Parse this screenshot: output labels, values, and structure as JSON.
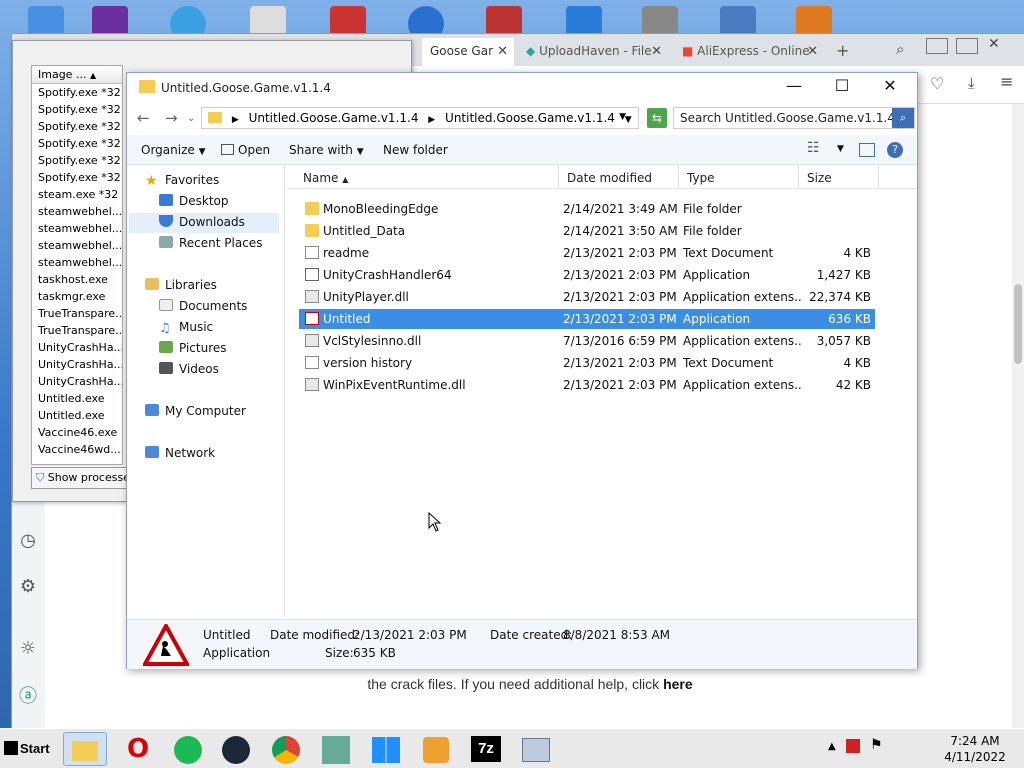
{
  "browser": {
    "tabs": [
      {
        "label": "Goose Gar",
        "active": true
      },
      {
        "label": "UploadHaven - File",
        "active": false
      },
      {
        "label": "AliExpress - Online",
        "active": false
      }
    ],
    "new_tab": "+",
    "page_text": "the crack files. If you need additional help, click",
    "page_link": "here"
  },
  "taskmgr": {
    "column": "Image ...",
    "processes": [
      "Spotify.exe *32",
      "Spotify.exe *32",
      "Spotify.exe *32",
      "Spotify.exe *32",
      "Spotify.exe *32",
      "Spotify.exe *32",
      "steam.exe *32",
      "steamwebhel...",
      "steamwebhel...",
      "steamwebhel...",
      "steamwebhel...",
      "taskhost.exe",
      "taskmgr.exe",
      "TrueTranspare...",
      "TrueTranspare...",
      "UnityCrashHa...",
      "UnityCrashHa...",
      "UnityCrashHa...",
      "Untitled.exe",
      "Untitled.exe",
      "Vaccine46.exe",
      "Vaccine46wd...."
    ],
    "show_processes": "Show processe"
  },
  "explorer": {
    "title": "Untitled.Goose.Game.v1.1.4",
    "breadcrumb": [
      "Untitled.Goose.Game.v1.1.4",
      "Untitled.Goose.Game.v1.1.4"
    ],
    "search_placeholder": "Search Untitled.Goose.Game.v1.1.4",
    "toolbar": {
      "organize": "Organize",
      "open": "Open",
      "share_with": "Share with",
      "new_folder": "New folder"
    },
    "nav": {
      "favorites": "Favorites",
      "desktop": "Desktop",
      "downloads": "Downloads",
      "recent_places": "Recent Places",
      "libraries": "Libraries",
      "documents": "Documents",
      "music": "Music",
      "pictures": "Pictures",
      "videos": "Videos",
      "my_computer": "My Computer",
      "network": "Network"
    },
    "columns": {
      "name": "Name",
      "date_modified": "Date modified",
      "type": "Type",
      "size": "Size"
    },
    "files": [
      {
        "name": "MonoBleedingEdge",
        "date": "2/14/2021 3:49 AM",
        "type": "File folder",
        "size": "",
        "icon": "folder-icon"
      },
      {
        "name": "Untitled_Data",
        "date": "2/14/2021 3:50 AM",
        "type": "File folder",
        "size": "",
        "icon": "folder-icon"
      },
      {
        "name": "readme",
        "date": "2/13/2021 2:03 PM",
        "type": "Text Document",
        "size": "4 KB",
        "icon": "text-file-icon"
      },
      {
        "name": "UnityCrashHandler64",
        "date": "2/13/2021 2:03 PM",
        "type": "Application",
        "size": "1,427 KB",
        "icon": "unity-icon"
      },
      {
        "name": "UnityPlayer.dll",
        "date": "2/13/2021 2:03 PM",
        "type": "Application extens...",
        "size": "22,374 KB",
        "icon": "dll-icon"
      },
      {
        "name": "Untitled",
        "date": "2/13/2021 2:03 PM",
        "type": "Application",
        "size": "636 KB",
        "icon": "goose-icon",
        "selected": true
      },
      {
        "name": "VclStylesinno.dll",
        "date": "7/13/2016 6:59 PM",
        "type": "Application extens...",
        "size": "3,057 KB",
        "icon": "dll-icon"
      },
      {
        "name": "version history",
        "date": "2/13/2021 2:03 PM",
        "type": "Text Document",
        "size": "4 KB",
        "icon": "text-file-icon"
      },
      {
        "name": "WinPixEventRuntime.dll",
        "date": "2/13/2021 2:03 PM",
        "type": "Application extens...",
        "size": "42 KB",
        "icon": "dll-icon"
      }
    ],
    "details": {
      "name": "Untitled",
      "type": "Application",
      "date_modified_label": "Date modified:",
      "date_modified": "2/13/2021 2:03 PM",
      "date_created_label": "Date created:",
      "date_created": "8/8/2021 8:53 AM",
      "size_label": "Size:",
      "size": "635 KB"
    }
  },
  "taskbar": {
    "start": "Start",
    "apps": [
      "explorer-icon",
      "opera-icon",
      "spotify-icon",
      "steam-icon",
      "chrome-icon",
      "installer-icon",
      "windows-icon",
      "media-player-icon",
      "7zip-icon",
      "task-manager-icon"
    ],
    "time": "7:24 AM",
    "date": "4/11/2022"
  },
  "colors": {
    "selection": "#3a8ee6",
    "folder": "#f5cd55",
    "accent": "#3c6fb5"
  }
}
